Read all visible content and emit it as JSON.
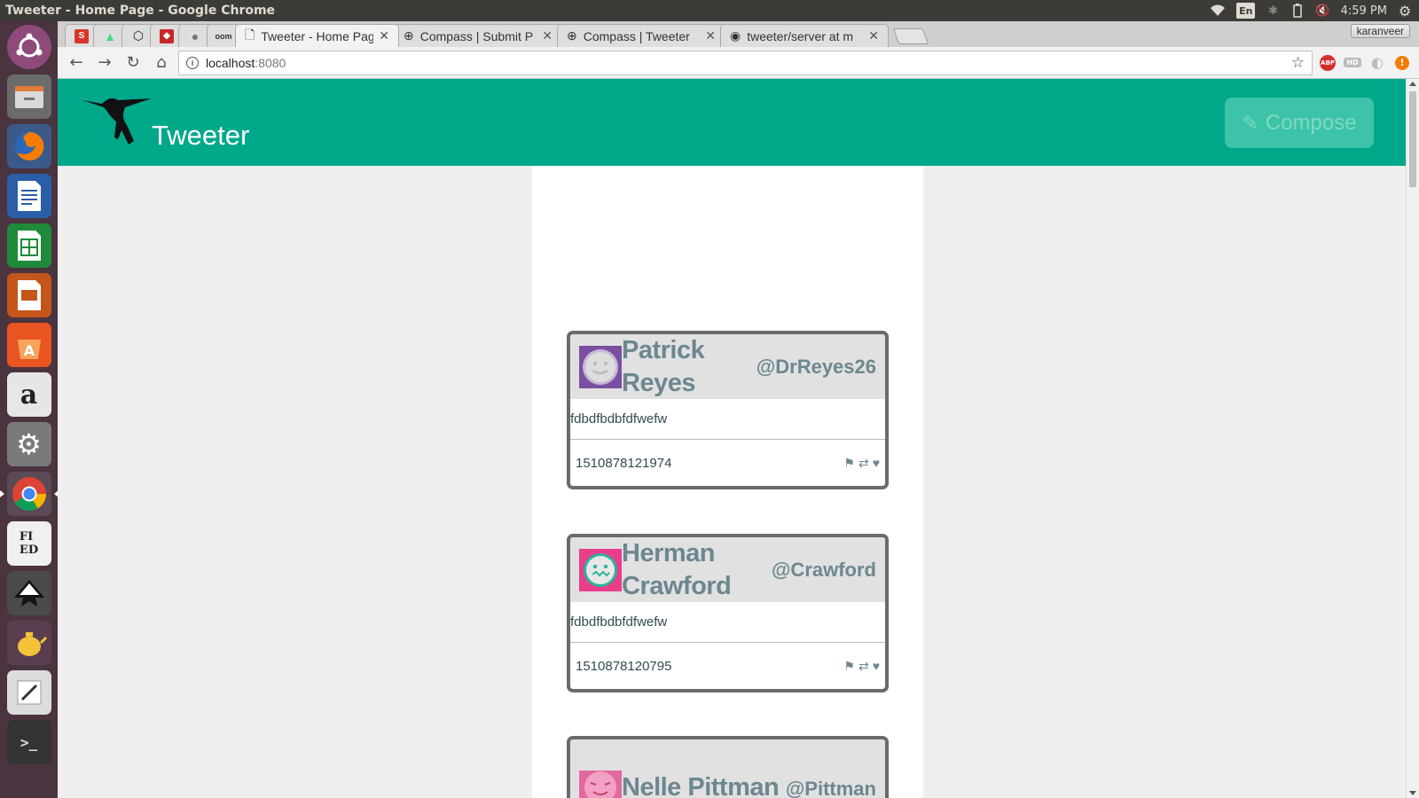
{
  "os": {
    "window_title": "Tweeter - Home Page - Google Chrome",
    "clock": "4:59 PM",
    "keyboard_lang": "En"
  },
  "browser": {
    "tabs": [
      {
        "label": "Tweeter - Home Pag",
        "active": true
      },
      {
        "label": "Compass | Submit P",
        "active": false
      },
      {
        "label": "Compass | Tweeter",
        "active": false
      },
      {
        "label": "tweeter/server at m",
        "active": false
      }
    ],
    "profile_name": "karanveer",
    "url_host": "localhost",
    "url_port": ":8080",
    "extensions": [
      "ABP",
      "HD"
    ]
  },
  "app": {
    "name": "Tweeter",
    "compose_label": "Compose",
    "accent_color": "#00a88a"
  },
  "tweets": [
    {
      "name": "Patrick Reyes",
      "handle": "@DrReyes26",
      "content": "fdbdfbdbfdfwefw",
      "timestamp": "1510878121974",
      "avatar_color": "#7b4fa0"
    },
    {
      "name": "Herman Crawford",
      "handle": "@Crawford",
      "content": "fdbdfbdbfdfwefw",
      "timestamp": "1510878120795",
      "avatar_color": "#e83e8c"
    },
    {
      "name": "Nelle Pittman",
      "handle": "@Pittman",
      "content": "",
      "timestamp": "",
      "avatar_color": "#e06aa0"
    }
  ]
}
